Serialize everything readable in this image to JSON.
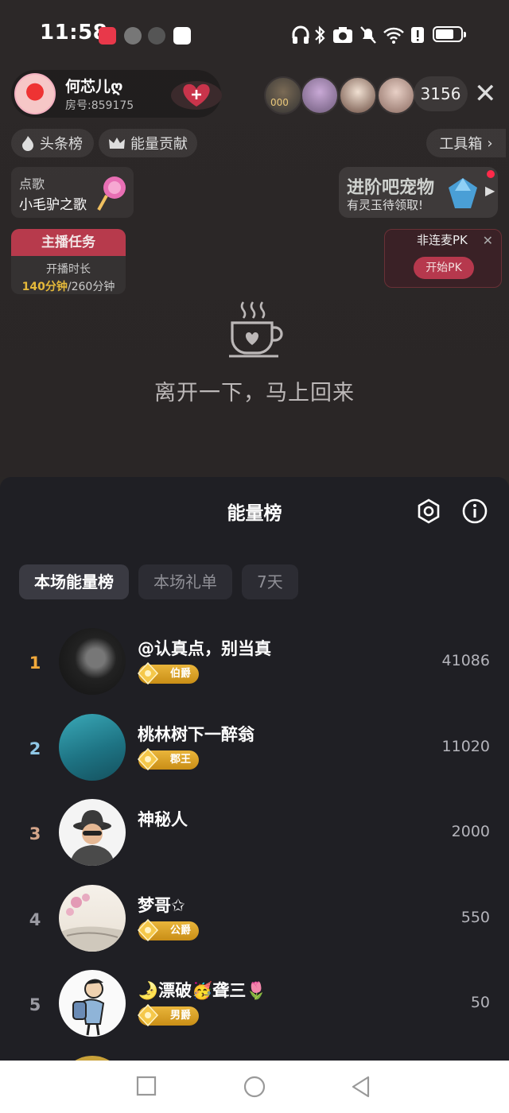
{
  "status_bar": {
    "time": "11:58"
  },
  "host": {
    "name": "何芯儿ღ",
    "room": "房号:859175"
  },
  "viewer_count": "3156",
  "viewer_badge": "000",
  "rank_pills": {
    "headline": "头条榜",
    "energy": "能量贡献"
  },
  "toolbox": "工具箱",
  "song": {
    "label": "点歌",
    "title": "小毛驴之歌"
  },
  "pet": {
    "title": "进阶吧宠物",
    "subtitle": "有灵玉待领取!"
  },
  "task": {
    "title": "主播任务",
    "label": "开播时长",
    "done": "140分钟",
    "total": "/260分钟"
  },
  "pk": {
    "title": "非连麦PK",
    "button": "开始PK"
  },
  "away_message": "离开一下，马上回来",
  "panel": {
    "title": "能量榜",
    "tabs": [
      "本场能量榜",
      "本场礼单",
      "7天"
    ],
    "rows": [
      {
        "rank": "1",
        "name": "@认真点，别当真",
        "badge": "伯爵",
        "score": "41086"
      },
      {
        "rank": "2",
        "name": "桃林树下一醉翁",
        "badge": "郡王",
        "score": "11020"
      },
      {
        "rank": "3",
        "name": "神秘人",
        "badge": "",
        "score": "2000"
      },
      {
        "rank": "4",
        "name": "梦哥✩",
        "badge": "公爵",
        "score": "550"
      },
      {
        "rank": "5",
        "name": "🌛漂破🥳聋三🌷",
        "badge": "男爵",
        "score": "50"
      }
    ]
  },
  "colors": {
    "rank1": "#f2a93b",
    "rank2": "#8fc7e6",
    "rank3": "#d4a58a",
    "rank_other": "#9a9aa2",
    "accent": "#b6384d",
    "badge_gold": "#e2a62a"
  }
}
